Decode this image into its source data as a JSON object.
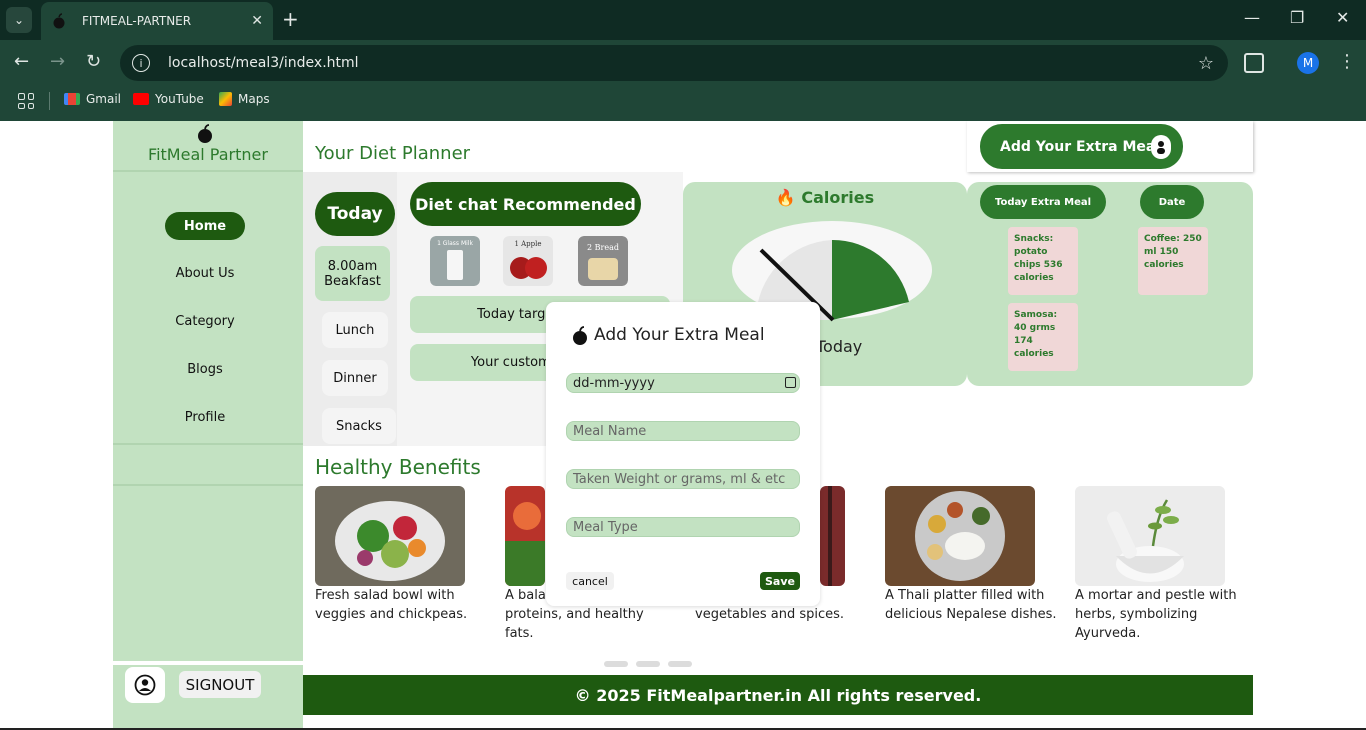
{
  "browser": {
    "tab_title": "FITMEAL-PARTNER",
    "url": "localhost/meal3/index.html",
    "profile_initial": "M",
    "bookmarks": [
      {
        "label": "Gmail"
      },
      {
        "label": "YouTube"
      },
      {
        "label": "Maps"
      }
    ]
  },
  "sidebar": {
    "brand": "FitMeal Partner",
    "items": [
      {
        "label": "Home",
        "active": true
      },
      {
        "label": "About Us"
      },
      {
        "label": "Category"
      },
      {
        "label": "Blogs"
      },
      {
        "label": "Profile"
      }
    ],
    "signout_label": "SIGNOUT"
  },
  "header": {
    "title": "Your Diet Planner",
    "extra_meal_button": "Add Your Extra Meal"
  },
  "schedule": {
    "today": "Today",
    "items": [
      "8.00am Beakfast",
      "Lunch",
      "Dinner",
      "Snacks"
    ]
  },
  "diet": {
    "recommended_label": "Diet chat Recommended",
    "thumbs": [
      {
        "caption": "1 Glass Milk"
      },
      {
        "caption": "1 Apple"
      },
      {
        "caption": "2 Bread"
      }
    ],
    "target_label": "Today target:",
    "custom_label": "Your customise"
  },
  "calories": {
    "title": "Calories",
    "today_label": "Today"
  },
  "extra_meals": {
    "col1_header": "Today Extra Meal",
    "col2_header": "Date",
    "notes": [
      "Snacks: potato chips 536 calories",
      "Coffee: 250 ml 150 calories",
      "Samosa: 40 grms 174 calories"
    ]
  },
  "benefits": {
    "title": "Healthy Benefits",
    "cards": [
      {
        "text": "Fresh salad bowl with veggies and chickpeas."
      },
      {
        "text": "A bala veggies, proteins, and healthy fats."
      },
      {
        "text": "salad with fresh vegetables and spices."
      },
      {
        "text": "A Thali platter filled with delicious Nepalese dishes."
      },
      {
        "text": "A mortar and pestle with herbs, symbolizing Ayurveda."
      }
    ]
  },
  "footer": {
    "text": "© 2025 FitMealpartner.in All rights reserved."
  },
  "modal": {
    "title": "Add Your Extra Meal",
    "date_value": "dd-mm-yyyy",
    "meal_name_placeholder": "Meal Name",
    "weight_placeholder": "Taken Weight or grams, ml & etc",
    "meal_type_placeholder": "Meal Type",
    "cancel_label": "cancel",
    "save_label": "Save"
  },
  "colors": {
    "brand_green": "#2d7a2d",
    "dark_green": "#1e5a10",
    "panel_green": "#c3e2c2"
  }
}
